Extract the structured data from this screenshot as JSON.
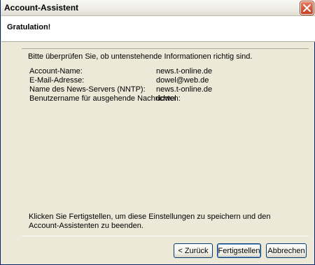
{
  "window": {
    "title": "Account-Assistent",
    "close_icon": "close-icon"
  },
  "header": {
    "title": "Gratulation!"
  },
  "main": {
    "instructions": "Bitte überprüfen Sie, ob untenstehende Informationen richtig sind.",
    "rows": [
      {
        "label": "Account-Name:",
        "value": "news.t-online.de"
      },
      {
        "label": "E-Mail-Adresse:",
        "value": "dowel@web.de"
      },
      {
        "label": "Name des News-Servers (NNTP):",
        "value": "news.t-online.de"
      },
      {
        "label": "Benutzername für ausgehende Nachrichten:",
        "value": "dowel"
      }
    ],
    "footer_text": "Klicken Sie Fertigstellen, um diese Einstellungen zu speichern und den Account-Assistenten zu beenden."
  },
  "buttons": {
    "back": "< Zurück",
    "finish": "Fertigstellen",
    "cancel": "Abbrechen"
  },
  "colors": {
    "close_button": "#c5401f",
    "window_background": "#ece9d8"
  }
}
